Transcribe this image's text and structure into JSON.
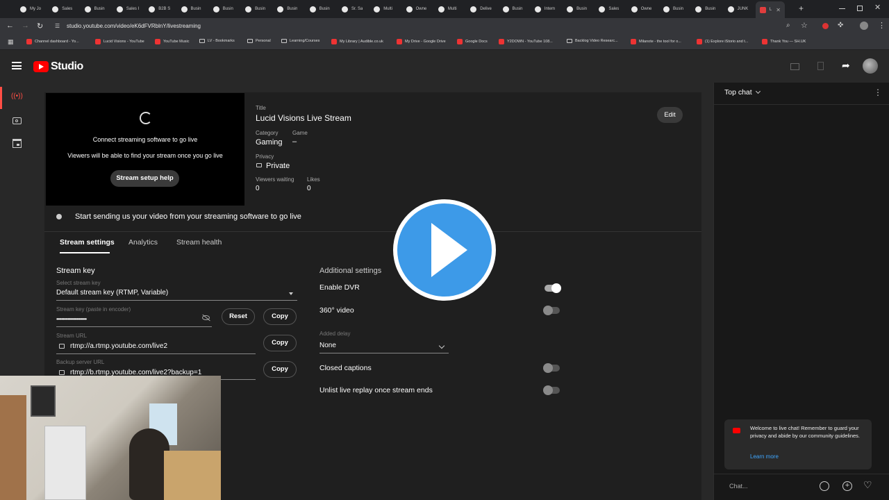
{
  "browser": {
    "tabs": [
      {
        "label": "My Jo"
      },
      {
        "label": "Sales"
      },
      {
        "label": "Busin"
      },
      {
        "label": "Sales I"
      },
      {
        "label": "B2B S"
      },
      {
        "label": "Busin"
      },
      {
        "label": "Busin"
      },
      {
        "label": "Busin"
      },
      {
        "label": "Busin"
      },
      {
        "label": "Busin"
      },
      {
        "label": "Sr. Sa"
      },
      {
        "label": "Multi"
      },
      {
        "label": "Owne"
      },
      {
        "label": "Multi"
      },
      {
        "label": "Delive"
      },
      {
        "label": "Busin"
      },
      {
        "label": "Intern"
      },
      {
        "label": "Busin"
      },
      {
        "label": "Sales"
      },
      {
        "label": "Owne"
      },
      {
        "label": "Busin"
      },
      {
        "label": "Busin"
      },
      {
        "label": "JUNK"
      },
      {
        "label": "L"
      }
    ],
    "new_tab": "+",
    "url": "studio.youtube.com/video/eK6dFVRblnY/livestreaming",
    "bookmarks": [
      {
        "label": "Channel dashboard - Yo..."
      },
      {
        "label": "Lucid Visions - YouTube"
      },
      {
        "label": "YouTube Music"
      },
      {
        "label": "LV - Bookmarks"
      },
      {
        "label": "Personal"
      },
      {
        "label": "Learning/Courses"
      },
      {
        "label": "My Library | Audible.co.uk"
      },
      {
        "label": "My Drive - Google Drive"
      },
      {
        "label": "Google Docs"
      },
      {
        "label": "Y2DOWN - YouTube 108..."
      },
      {
        "label": "Backlog Video Researc..."
      },
      {
        "label": "Milanote - the tool for o..."
      },
      {
        "label": "(1) Explore iStorio and t..."
      },
      {
        "label": "Thank You — SH.UK"
      }
    ]
  },
  "studio": {
    "logo_text": "Studio"
  },
  "preview": {
    "connect_text": "Connect streaming software to go live",
    "viewers_text": "Viewers will be able to find your stream once you go live",
    "setup_help": "Stream setup help"
  },
  "details": {
    "title_label": "Title",
    "title": "Lucid Visions Live Stream",
    "edit": "Edit",
    "category_label": "Category",
    "category": "Gaming",
    "game_label": "Game",
    "game": "–",
    "privacy_label": "Privacy",
    "privacy": "Private",
    "viewers_waiting_label": "Viewers waiting",
    "viewers_waiting": "0",
    "likes_label": "Likes",
    "likes": "0"
  },
  "status_text": "Start sending us your video from your streaming software to go live",
  "tabs": [
    {
      "label": "Stream settings"
    },
    {
      "label": "Analytics"
    },
    {
      "label": "Stream health"
    }
  ],
  "stream_key": {
    "heading": "Stream key",
    "select_label": "Select stream key",
    "select_value": "Default stream key (RTMP, Variable)",
    "key_label": "Stream key (paste in encoder)",
    "key_value": "••••••••••••••••••••••••",
    "reset": "Reset",
    "copy": "Copy",
    "url_label": "Stream URL",
    "url_value": "rtmp://a.rtmp.youtube.com/live2",
    "backup_label": "Backup server URL",
    "backup_value": "rtmp://b.rtmp.youtube.com/live2?backup=1"
  },
  "additional": {
    "heading": "Additional settings",
    "dvr": "Enable DVR",
    "dvr_on": true,
    "video360": "360° video",
    "video360_on": false,
    "delay_label": "Added delay",
    "delay_value": "None",
    "captions": "Closed captions",
    "captions_on": false,
    "unlist": "Unlist live replay once stream ends",
    "unlist_on": false
  },
  "chat": {
    "mode": "Top chat",
    "welcome": "Welcome to live chat! Remember to guard your privacy and abide by our community guidelines.",
    "learn_more": "Learn more",
    "placeholder": "Chat..."
  },
  "colors": {
    "brand_red": "#ff0000",
    "play_blue": "#3d9ae8",
    "link_blue": "#3ea6ff"
  }
}
